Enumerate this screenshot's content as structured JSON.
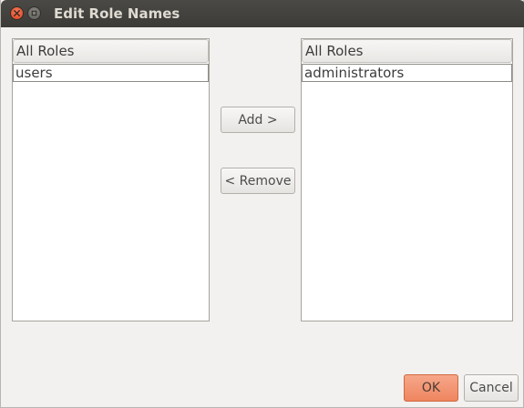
{
  "window": {
    "title": "Edit Role Names"
  },
  "left_list": {
    "header": "All Roles",
    "items": [
      "users"
    ]
  },
  "right_list": {
    "header": "All Roles",
    "items": [
      "administrators"
    ]
  },
  "buttons": {
    "add": "Add >",
    "remove": "< Remove",
    "ok": "OK",
    "cancel": "Cancel"
  },
  "colors": {
    "titlebar": "#3c3b37",
    "close_button": "#e2421c",
    "ok_button": "#ef855f",
    "window_bg": "#f2f1f0"
  }
}
